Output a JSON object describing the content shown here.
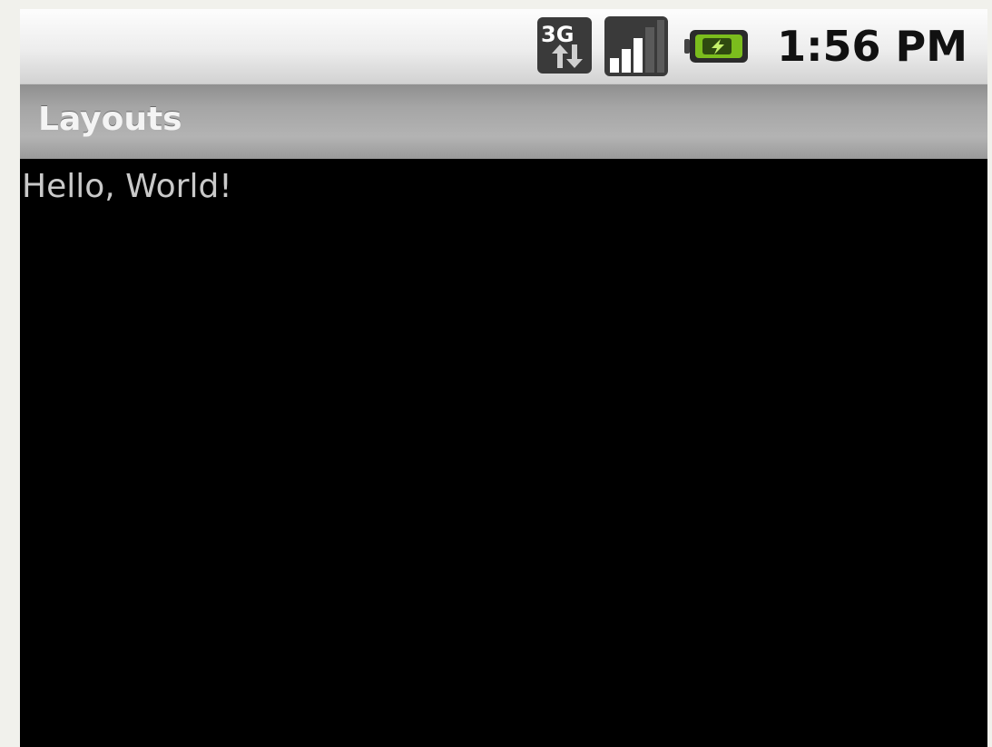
{
  "status_bar": {
    "network_label": "3G",
    "time": "1:56 PM",
    "icons": [
      "network-3g-icon",
      "signal-strength-icon",
      "battery-charging-icon"
    ],
    "battery_color": "#7bbd1d"
  },
  "app": {
    "title": "Layouts"
  },
  "content": {
    "text": "Hello, World!"
  }
}
